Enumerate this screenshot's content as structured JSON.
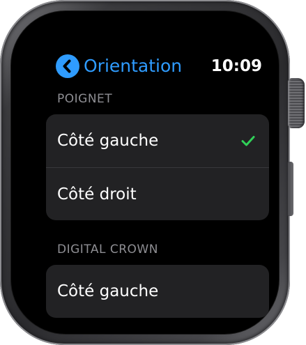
{
  "header": {
    "back_label": "Orientation",
    "time": "10:09"
  },
  "sections": [
    {
      "title": "POIGNET",
      "options": [
        {
          "label": "Côté gauche",
          "selected": true
        },
        {
          "label": "Côté droit",
          "selected": false
        }
      ]
    },
    {
      "title": "DIGITAL CROWN",
      "options": [
        {
          "label": "Côté gauche",
          "selected": false
        }
      ]
    }
  ],
  "colors": {
    "accent": "#2f9cff",
    "check": "#30d158",
    "row_background": "#222224",
    "section_header": "#8e8e93"
  },
  "icons": {
    "back": "chevron-left-icon",
    "check": "checkmark-icon"
  }
}
